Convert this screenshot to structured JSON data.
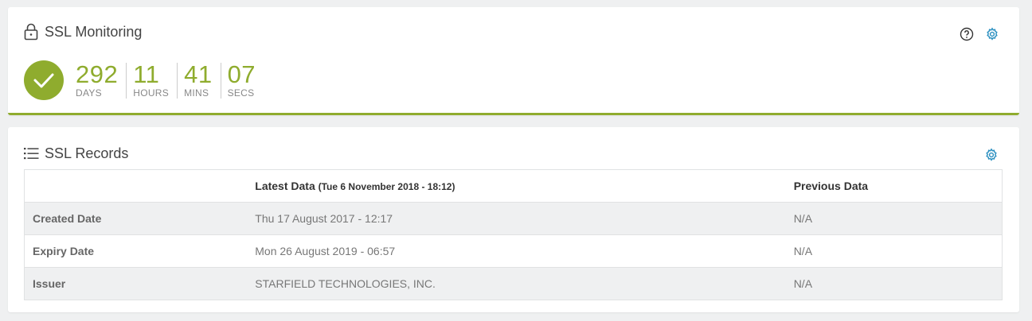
{
  "monitoring": {
    "title": "SSL Monitoring",
    "status": "ok",
    "accent_color": "#8fac2e",
    "countdown": [
      {
        "value": "292",
        "label": "DAYS"
      },
      {
        "value": "11",
        "label": "HOURS"
      },
      {
        "value": "41",
        "label": "MINS"
      },
      {
        "value": "07",
        "label": "SECS"
      }
    ],
    "icons": {
      "title": "lock-icon",
      "help": "help-icon",
      "settings": "gear-icon",
      "status": "check-icon"
    }
  },
  "records": {
    "title": "SSL Records",
    "icons": {
      "title": "list-icon",
      "settings": "gear-icon"
    },
    "columns": {
      "empty": "",
      "latest": "Latest Data",
      "latest_sub": "(Tue 6 November 2018 - 18:12)",
      "previous": "Previous Data"
    },
    "rows": [
      {
        "label": "Created Date",
        "latest": "Thu 17 August 2017 - 12:17",
        "previous": "N/A"
      },
      {
        "label": "Expiry Date",
        "latest": "Mon 26 August 2019 - 06:57",
        "previous": "N/A"
      },
      {
        "label": "Issuer",
        "latest": "STARFIELD TECHNOLOGIES, INC.",
        "previous": "N/A"
      }
    ]
  }
}
